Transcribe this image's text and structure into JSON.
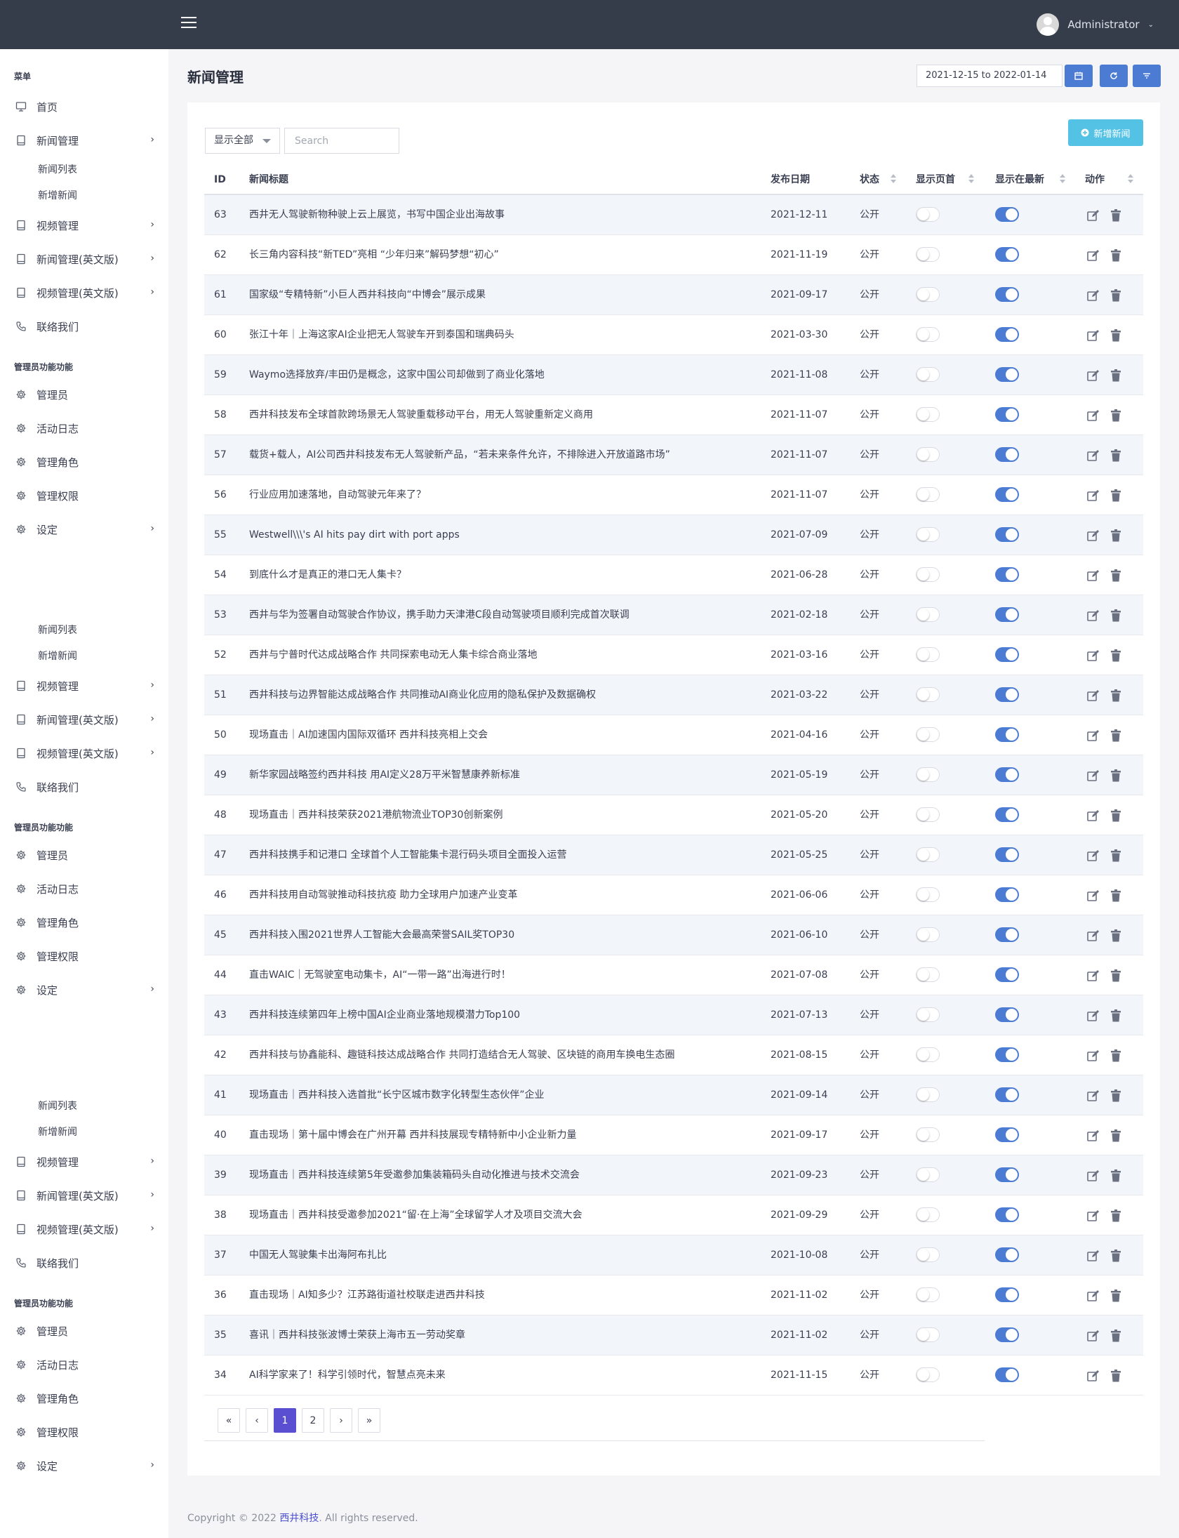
{
  "topbar": {
    "user_name": "Administrator"
  },
  "sidebar": {
    "blocks": [
      {
        "menu_title": "菜单",
        "items": [
          {
            "label": "首页",
            "icon": "monitor-icon",
            "sub": []
          },
          {
            "label": "新闻管理",
            "icon": "book-icon",
            "chevron": true,
            "sub": [
              "新闻列表",
              "新增新闻"
            ]
          },
          {
            "label": "视频管理",
            "icon": "book-icon",
            "chevron": true,
            "sub": []
          },
          {
            "label": "新闻管理(英文版)",
            "icon": "book-icon",
            "chevron": true,
            "sub": []
          },
          {
            "label": "视频管理(英文版)",
            "icon": "book-icon",
            "chevron": true,
            "sub": []
          },
          {
            "label": "联络我们",
            "icon": "phone-icon",
            "sub": []
          }
        ],
        "admin_title": "管理员功能功能",
        "admin_items": [
          {
            "label": "管理员",
            "icon": "gear-icon"
          },
          {
            "label": "活动日志",
            "icon": "gear-icon"
          },
          {
            "label": "管理角色",
            "icon": "gear-icon"
          },
          {
            "label": "管理权限",
            "icon": "gear-icon"
          },
          {
            "label": "设定",
            "icon": "gear-icon",
            "chevron": true
          }
        ]
      }
    ],
    "repeat": {
      "sub_items": [
        "新闻列表",
        "新增新闻"
      ],
      "items": [
        "视频管理",
        "新闻管理(英文版)",
        "视频管理(英文版)",
        "联络我们"
      ],
      "admin_title": "管理员功能功能",
      "admin_items": [
        "管理员",
        "活动日志",
        "管理角色",
        "管理权限",
        "设定"
      ]
    }
  },
  "page": {
    "title": "新闻管理",
    "date_range": "2021-12-15 to 2022-01-14",
    "add_button": "新增新闻",
    "filter_select": "显示全部",
    "search_placeholder": "Search"
  },
  "table": {
    "columns": [
      "ID",
      "新闻标题",
      "发布日期",
      "状态",
      "显示页首",
      "显示在最新",
      "动作"
    ],
    "rows": [
      {
        "id": "63",
        "title": "西井无人驾驶新物种驶上云上展览，书写中国企业出海故事",
        "date": "2021-12-11",
        "status": "公开",
        "home": false,
        "latest": true
      },
      {
        "id": "62",
        "title": "长三角内容科技“新TED”亮相 “少年归来”解码梦想“初心”",
        "date": "2021-11-19",
        "status": "公开",
        "home": false,
        "latest": true
      },
      {
        "id": "61",
        "title": "国家级“专精特新”小巨人西井科技向“中博会”展示成果",
        "date": "2021-09-17",
        "status": "公开",
        "home": false,
        "latest": true
      },
      {
        "id": "60",
        "title": "张江十年｜上海这家AI企业把无人驾驶车开到泰国和瑞典码头",
        "date": "2021-03-30",
        "status": "公开",
        "home": false,
        "latest": true
      },
      {
        "id": "59",
        "title": "Waymo选择放弃/丰田仍是概念，这家中国公司却做到了商业化落地",
        "date": "2021-11-08",
        "status": "公开",
        "home": false,
        "latest": true
      },
      {
        "id": "58",
        "title": "西井科技发布全球首款跨场景无人驾驶重载移动平台，用无人驾驶重新定义商用",
        "date": "2021-11-07",
        "status": "公开",
        "home": false,
        "latest": true
      },
      {
        "id": "57",
        "title": "载货+载人，AI公司西井科技发布无人驾驶新产品，“若未来条件允许，不排除进入开放道路市场”",
        "date": "2021-11-07",
        "status": "公开",
        "home": false,
        "latest": true
      },
      {
        "id": "56",
        "title": "行业应用加速落地，自动驾驶元年来了？",
        "date": "2021-11-07",
        "status": "公开",
        "home": false,
        "latest": true
      },
      {
        "id": "55",
        "title": "Westwell\\\\\\'s AI hits pay dirt with port apps",
        "date": "2021-07-09",
        "status": "公开",
        "home": false,
        "latest": true
      },
      {
        "id": "54",
        "title": "到底什么才是真正的港口无人集卡？",
        "date": "2021-06-28",
        "status": "公开",
        "home": false,
        "latest": true
      },
      {
        "id": "53",
        "title": "西井与华为签署自动驾驶合作协议，携手助力天津港C段自动驾驶项目顺利完成首次联调",
        "date": "2021-02-18",
        "status": "公开",
        "home": false,
        "latest": true
      },
      {
        "id": "52",
        "title": "西井与宁普时代达成战略合作 共同探索电动无人集卡综合商业落地",
        "date": "2021-03-16",
        "status": "公开",
        "home": false,
        "latest": true
      },
      {
        "id": "51",
        "title": "西井科技与边界智能达成战略合作 共同推动AI商业化应用的隐私保护及数据确权",
        "date": "2021-03-22",
        "status": "公开",
        "home": false,
        "latest": true
      },
      {
        "id": "50",
        "title": "现场直击｜AI加速国内国际双循环 西井科技亮相上交会",
        "date": "2021-04-16",
        "status": "公开",
        "home": false,
        "latest": true
      },
      {
        "id": "49",
        "title": "新华家园战略签约西井科技 用AI定义28万平米智慧康养新标准",
        "date": "2021-05-19",
        "status": "公开",
        "home": false,
        "latest": true
      },
      {
        "id": "48",
        "title": "现场直击｜西井科技荣获2021港航物流业TOP30创新案例",
        "date": "2021-05-20",
        "status": "公开",
        "home": false,
        "latest": true
      },
      {
        "id": "47",
        "title": "西井科技携手和记港口 全球首个人工智能集卡混行码头项目全面投入运营",
        "date": "2021-05-25",
        "status": "公开",
        "home": false,
        "latest": true
      },
      {
        "id": "46",
        "title": "西井科技用自动驾驶推动科技抗疫 助力全球用户加速产业变革",
        "date": "2021-06-06",
        "status": "公开",
        "home": false,
        "latest": true
      },
      {
        "id": "45",
        "title": "西井科技入围2021世界人工智能大会最高荣誉SAIL奖TOP30",
        "date": "2021-06-10",
        "status": "公开",
        "home": false,
        "latest": true
      },
      {
        "id": "44",
        "title": "直击WAIC｜无驾驶室电动集卡，AI“一带一路”出海进行时！",
        "date": "2021-07-08",
        "status": "公开",
        "home": false,
        "latest": true
      },
      {
        "id": "43",
        "title": "西井科技连续第四年上榜中国AI企业商业落地规模潜力Top100",
        "date": "2021-07-13",
        "status": "公开",
        "home": false,
        "latest": true
      },
      {
        "id": "42",
        "title": "西井科技与协鑫能科、趣链科技达成战略合作 共同打造结合无人驾驶、区块链的商用车换电生态圈",
        "date": "2021-08-15",
        "status": "公开",
        "home": false,
        "latest": true
      },
      {
        "id": "41",
        "title": "现场直击｜西井科技入选首批“长宁区城市数字化转型生态伙伴”企业",
        "date": "2021-09-14",
        "status": "公开",
        "home": false,
        "latest": true
      },
      {
        "id": "40",
        "title": "直击现场｜第十届中博会在广州开幕 西井科技展现专精特新中小企业新力量",
        "date": "2021-09-17",
        "status": "公开",
        "home": false,
        "latest": true
      },
      {
        "id": "39",
        "title": "现场直击｜西井科技连续第5年受邀参加集装箱码头自动化推进与技术交流会",
        "date": "2021-09-23",
        "status": "公开",
        "home": false,
        "latest": true
      },
      {
        "id": "38",
        "title": "现场直击｜西井科技受邀参加2021“留·在上海”全球留学人才及项目交流大会",
        "date": "2021-09-29",
        "status": "公开",
        "home": false,
        "latest": true
      },
      {
        "id": "37",
        "title": "中国无人驾驶集卡出海阿布扎比",
        "date": "2021-10-08",
        "status": "公开",
        "home": false,
        "latest": true
      },
      {
        "id": "36",
        "title": "直击现场｜AI知多少？江苏路街道社校联走进西井科技",
        "date": "2021-11-02",
        "status": "公开",
        "home": false,
        "latest": true
      },
      {
        "id": "35",
        "title": "喜讯｜西井科技张波博士荣获上海市五一劳动奖章",
        "date": "2021-11-02",
        "status": "公开",
        "home": false,
        "latest": true
      },
      {
        "id": "34",
        "title": "AI科学家来了！科学引领时代，智慧点亮未来",
        "date": "2021-11-15",
        "status": "公开",
        "home": false,
        "latest": true
      }
    ]
  },
  "pagination": {
    "first": "«",
    "prev": "‹",
    "pages": [
      "1",
      "2"
    ],
    "active": "1",
    "next": "›",
    "last": "»"
  },
  "footer": {
    "prefix": "Copyright © 2022 ",
    "brand": "西井科技",
    "suffix": ". All rights reserved."
  },
  "colors": {
    "topbar": "#353d4a",
    "primary": "#4b7bd3",
    "add_button": "#53c2e4",
    "pagination_active": "#5b4fd1"
  }
}
